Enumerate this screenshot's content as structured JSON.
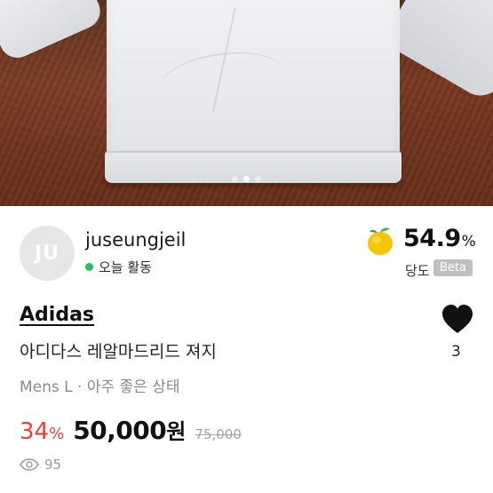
{
  "gallery": {
    "pagination": {
      "total": 3,
      "active_index": 1
    }
  },
  "seller": {
    "avatar_initials": "JU",
    "name": "juseungjeil",
    "status": "오늘 활동",
    "status_color": "#22c55e"
  },
  "trust_score": {
    "icon": "lemon-icon",
    "value": "54.9",
    "unit": "%",
    "label": "당도",
    "badge": "Beta"
  },
  "product": {
    "brand": "Adidas",
    "title": "아디다스 레알마드리드 져지",
    "condition": "Mens L · 아주 좋은 상태",
    "likes": "3",
    "like_icon": "heart-icon"
  },
  "pricing": {
    "discount_value": "34",
    "discount_unit": "%",
    "price": "50,000",
    "price_unit": "원",
    "original_price": "75,000",
    "discount_color": "#ef3a3a"
  },
  "stats": {
    "views": "95",
    "views_icon": "eye-icon"
  }
}
